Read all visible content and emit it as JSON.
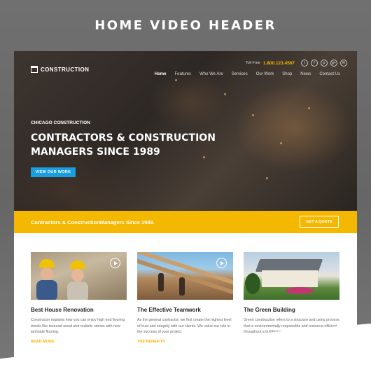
{
  "caption": "HOME VIDEO HEADER",
  "site": {
    "brand": "CONSTRUCTION",
    "toll_label": "Toll Free",
    "toll_number": "1.800.123.4567",
    "social": [
      {
        "icon": "twitter-icon",
        "glyph": "t"
      },
      {
        "icon": "facebook-icon",
        "glyph": "f"
      },
      {
        "icon": "pinterest-icon",
        "glyph": "p"
      },
      {
        "icon": "google-plus-icon",
        "glyph": "g+"
      },
      {
        "icon": "email-icon",
        "glyph": "✉"
      }
    ],
    "nav": [
      "Home",
      "Features",
      "Who We Are",
      "Services",
      "Our Work",
      "Shop",
      "News",
      "Contact Us"
    ],
    "nav_active": "Home",
    "hero": {
      "eyebrow": "CHICAGO CONSTRUCTION",
      "headline_line1": "CONTRACTORS & CONSTRUCTION",
      "headline_line2": "MANAGERS SINCE 1989",
      "cta": "VIEW OUR WORK"
    },
    "band": {
      "text": "Contractors & ConstructionManagers Since 1989.",
      "button": "GET A QUOTE"
    },
    "cards": [
      {
        "title": "Best House Renovation",
        "body": "Constructor explains how you can enjoy high end flooring trends like textured wood and realistic stones with new laminate flooring.",
        "link": "READ MORE"
      },
      {
        "title": "The Effective Teamwork",
        "body": "As the general contractor, we first create the highest level of trust and integrity with our clients. We value our role in the success of your project.",
        "link": "THE BENEFITS"
      },
      {
        "title": "The Green Building",
        "body": "Green construction refers to a structure and using process that is environmentally responsible and resource-efficient throughout a building's",
        "link": ""
      }
    ]
  },
  "colors": {
    "accent": "#f5b800",
    "cta": "#1a9ee0",
    "background": "#6b6b6b"
  }
}
